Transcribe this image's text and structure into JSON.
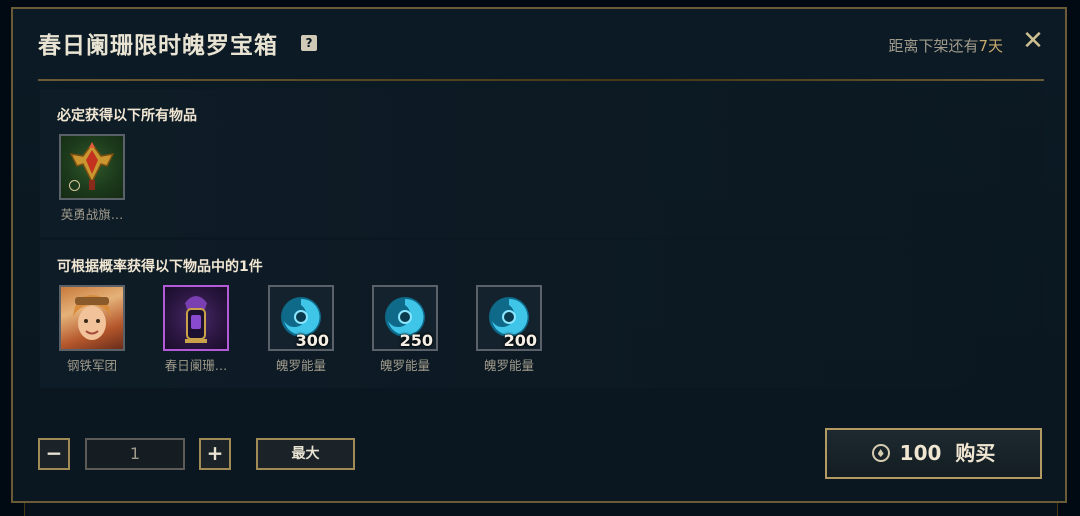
{
  "dialog": {
    "title": "春日阑珊限时魄罗宝箱",
    "help_icon": "?",
    "remaining_prefix": "距离下架还有",
    "remaining_days": "7天",
    "close_icon": "✕"
  },
  "guaranteed": {
    "title": "必定获得以下所有物品",
    "items": [
      {
        "label": "英勇战旗…",
        "icon": "banner-emblem-icon"
      }
    ]
  },
  "random": {
    "title": "可根据概率获得以下物品中的1件",
    "items": [
      {
        "label": "钢铁军团",
        "icon": "champion-skin-portrait"
      },
      {
        "label": "春日阑珊…",
        "icon": "ward-skin-icon"
      },
      {
        "label": "魄罗能量",
        "quantity": "300",
        "icon": "poro-energy-icon"
      },
      {
        "label": "魄罗能量",
        "quantity": "250",
        "icon": "poro-energy-icon"
      },
      {
        "label": "魄罗能量",
        "quantity": "200",
        "icon": "poro-energy-icon"
      }
    ]
  },
  "controls": {
    "minus": "−",
    "quantity_value": "1",
    "plus": "+",
    "max_label": "最大",
    "price": "100",
    "buy_label": "购买"
  },
  "colors": {
    "gold_border": "#6a5a35",
    "accent_gold": "#c8aa6e",
    "rare_purple": "#b35ad6"
  }
}
